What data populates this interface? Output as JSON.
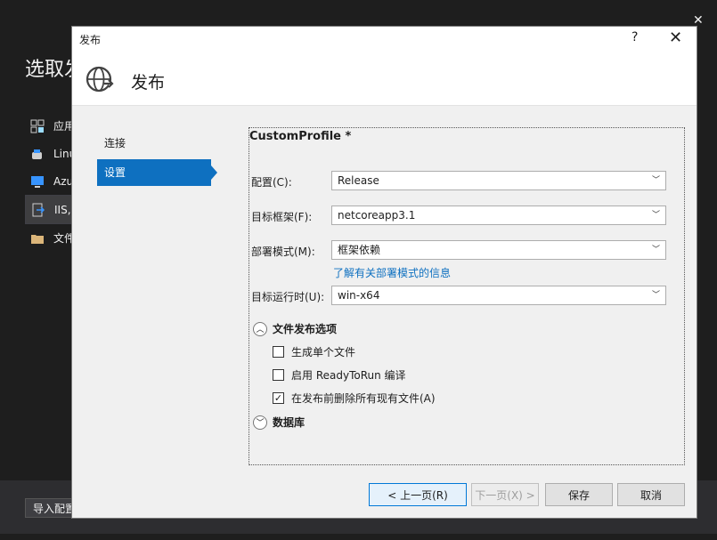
{
  "background": {
    "title": "选取发",
    "close_glyph": "✕",
    "items": [
      {
        "label": "应用",
        "icon": "app-icon"
      },
      {
        "label": "Linu",
        "icon": "linux-icon"
      },
      {
        "label": "Azu",
        "icon": "azure-icon"
      },
      {
        "label": "IIS,",
        "icon": "iis-icon"
      },
      {
        "label": "文件",
        "icon": "folder-icon"
      }
    ],
    "import_button": "导入配置"
  },
  "dialog": {
    "title": "发布",
    "help": "?",
    "close": "✕",
    "header_title": "发布",
    "nav": [
      {
        "label": "连接",
        "selected": false
      },
      {
        "label": "设置",
        "selected": true
      }
    ],
    "profile_name": "CustomProfile *",
    "fields": {
      "config": {
        "label": "配置(C):",
        "value": "Release"
      },
      "framework": {
        "label": "目标框架(F):",
        "value": "netcoreapp3.1"
      },
      "deploy_mode": {
        "label": "部署模式(M):",
        "value": "框架依赖"
      },
      "deploy_link": "了解有关部署模式的信息",
      "runtime": {
        "label": "目标运行时(U):",
        "value": "win-x64"
      }
    },
    "file_options": {
      "title": "文件发布选项",
      "expanded": true,
      "options": [
        {
          "label": "生成单个文件",
          "checked": false
        },
        {
          "label": "启用 ReadyToRun 编译",
          "checked": false
        },
        {
          "label": "在发布前删除所有现有文件(A)",
          "checked": true
        }
      ]
    },
    "database": {
      "title": "数据库",
      "expanded": false
    },
    "buttons": {
      "prev": "< 上一页(R)",
      "next": "下一页(X) >",
      "save": "保存",
      "cancel": "取消"
    }
  },
  "colors": {
    "accent": "#0e70c0",
    "background": "#1e1e1e"
  }
}
